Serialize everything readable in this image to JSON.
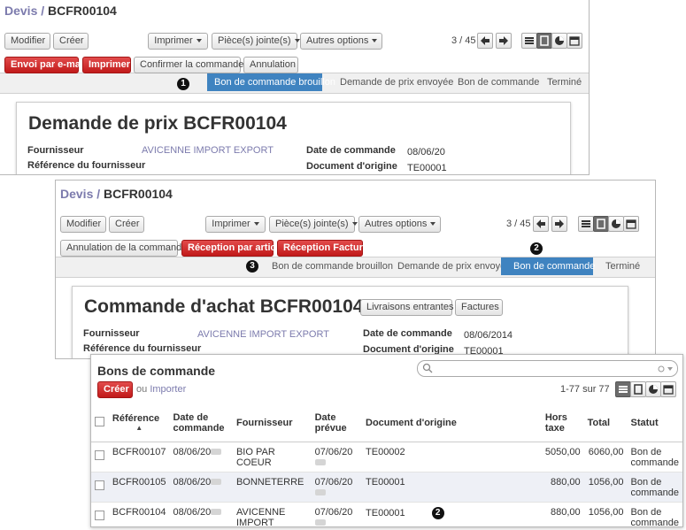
{
  "p1": {
    "breadcrumb_link": "Devis",
    "breadcrumb_sep": "/",
    "breadcrumb_current": "BCFR00104",
    "buttons": {
      "modifier": "Modifier",
      "creer": "Créer",
      "imprimer": "Imprimer",
      "pieces": "Pièce(s) jointe(s)",
      "autres": "Autres options"
    },
    "pager": "3 / 45",
    "actions": [
      "Envoi par e-mail",
      "Imprimer",
      "Confirmer la commande",
      "Annulation"
    ],
    "stages": [
      "Bon de commande brouillon",
      "Demande de prix envoyée",
      "Bon de commande",
      "Terminé"
    ],
    "badge": "1",
    "title_prefix": "Demande de prix",
    "title_code": "BCFR00104",
    "fields": {
      "fournisseur_label": "Fournisseur",
      "fournisseur_value": "AVICENNE IMPORT EXPORT",
      "ref_label": "Référence du fournisseur",
      "date_label": "Date de commande",
      "date_value": "08/06/20",
      "origine_label": "Document d'origine",
      "origine_value": "TE00001"
    }
  },
  "p2": {
    "breadcrumb_link": "Devis",
    "breadcrumb_sep": "/",
    "breadcrumb_current": "BCFR00104",
    "buttons": {
      "modifier": "Modifier",
      "creer": "Créer",
      "imprimer": "Imprimer",
      "pieces": "Pièce(s) jointe(s)",
      "autres": "Autres options"
    },
    "pager": "3 / 45",
    "actions": [
      "Annulation de la commande",
      "Réception par article",
      "Réception Facture"
    ],
    "stages": [
      "Bon de commande brouillon",
      "Demande de prix envoyée",
      "Bon de commande",
      "Terminé"
    ],
    "badge_stage": "2",
    "badge_actions": "3",
    "title_prefix": "Commande d'achat",
    "title_code": "BCFR00104",
    "smart_buttons": [
      "Livraisons entrantes",
      "Factures"
    ],
    "fields": {
      "fournisseur_label": "Fournisseur",
      "fournisseur_value": "AVICENNE IMPORT EXPORT",
      "ref_label": "Référence du fournisseur",
      "date_label": "Date de commande",
      "date_value": "08/06/2014",
      "origine_label": "Document d'origine",
      "origine_value": "TE00001"
    }
  },
  "p3": {
    "title": "Bons de commande",
    "create_label": "Créer",
    "or_label": "ou",
    "import_label": "Importer",
    "pager": "1-77 sur 77",
    "columns": [
      "Référence",
      "Date de commande",
      "Fournisseur",
      "Date prévue",
      "Document d'origine",
      "Hors taxe",
      "Total",
      "Statut"
    ],
    "rows": [
      {
        "ref": "BCFR00107",
        "date": "08/06/20",
        "fournisseur": "BIO PAR COEUR",
        "prevue": "07/06/20",
        "origine": "TE00002",
        "ht": "5050,00",
        "total": "6060,00",
        "statut": "Bon de commande"
      },
      {
        "ref": "BCFR00105",
        "date": "08/06/20",
        "fournisseur": "BONNETERRE",
        "prevue": "07/06/20",
        "origine": "TE00001",
        "ht": "880,00",
        "total": "1056,00",
        "statut": "Bon de commande"
      },
      {
        "ref": "BCFR00104",
        "date": "08/06/20",
        "fournisseur": "AVICENNE IMPORT EXPORT",
        "prevue": "07/06/20",
        "origine": "TE00001",
        "ht": "880,00",
        "total": "1056,00",
        "statut": "Bon de commande"
      }
    ],
    "badge": "2"
  }
}
